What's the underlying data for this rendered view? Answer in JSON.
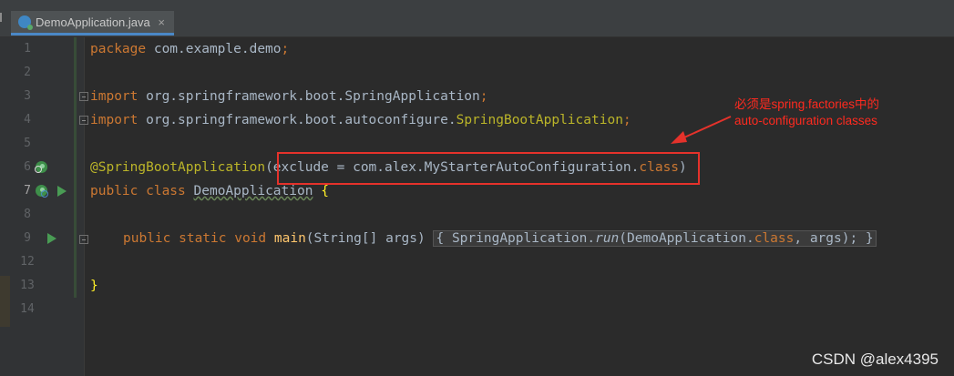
{
  "editor_tab": {
    "file_name": "DemoApplication.java",
    "close_glyph": "×"
  },
  "line_numbers": [
    "1",
    "2",
    "3",
    "4",
    "5",
    "6",
    "7",
    "8",
    "9",
    "12",
    "13",
    "14"
  ],
  "code": {
    "l1_kw": "package",
    "l1_rest": " com.example.demo",
    "l1_semi": ";",
    "l3_kw": "import",
    "l3_rest": " org.springframework.boot.SpringApplication",
    "l3_semi": ";",
    "l4_kw": "import",
    "l4_rest": " org.springframework.boot.autoconfigure.",
    "l4_cls": "SpringBootApplication",
    "l4_semi": ";",
    "l6_ann": "@SpringBootApplication",
    "l6_open": "(exclude = com.alex.MyStarterAutoConfiguration.",
    "l6_cls": "class",
    "l6_close": ")",
    "l7_kw": "public class",
    "l7_name": "DemoApplication",
    "l7_brace": "{",
    "l9_kw": "public static void",
    "l9_fn": "main",
    "l9_params": "(String[] args)",
    "l9_body_pre": "{ SpringApplication.",
    "l9_run": "run",
    "l9_body_mid": "(DemoApplication.",
    "l9_cls": "class",
    "l9_body_post": ", args); }",
    "l13_brace": "}"
  },
  "annotation": {
    "line1": "必须是spring.factories中的",
    "line2": "auto-configuration classes",
    "color": "#ff2a1f"
  },
  "watermark": "CSDN @alex4395"
}
